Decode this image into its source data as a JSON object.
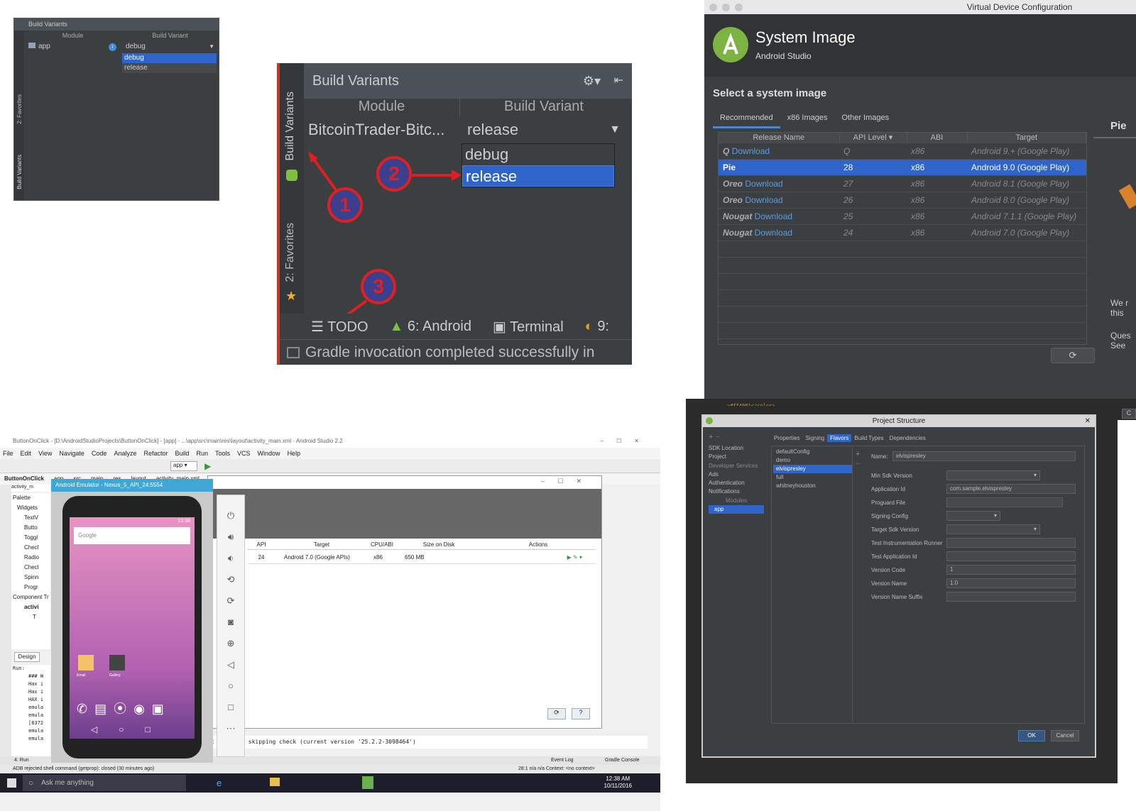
{
  "panel1": {
    "title": "Build Variants",
    "col_module": "Module",
    "col_variant": "Build Variant",
    "module": "app",
    "variant": "debug",
    "options": [
      "debug",
      "release"
    ],
    "side_favorites": "2: Favorites",
    "side_build": "Build Variants"
  },
  "panel2": {
    "title": "Build Variants",
    "col_module": "Module",
    "col_variant": "Build Variant",
    "module": "BitcoinTrader-Bitc...",
    "variant": "release",
    "options": [
      "debug",
      "release"
    ],
    "side_build": "Build Variants",
    "side_favorites": "2: Favorites",
    "markers": [
      "1",
      "2",
      "3"
    ],
    "bottom_tabs": [
      "TODO",
      "6: Android",
      "Terminal",
      "9:"
    ],
    "status": "Gradle invocation completed successfully in"
  },
  "panel3": {
    "window_title": "Virtual Device Configuration",
    "heading": "System Image",
    "subheading": "Android Studio",
    "prompt": "Select a system image",
    "tabs": [
      "Recommended",
      "x86 Images",
      "Other Images"
    ],
    "columns": [
      "Release Name",
      "API Level",
      "ABI",
      "Target"
    ],
    "rows": [
      {
        "name": "Q",
        "link": "Download",
        "api": "Q",
        "abi": "x86",
        "target": "Android 9.+ (Google Play)",
        "selected": false
      },
      {
        "name": "Pie",
        "link": "",
        "api": "28",
        "abi": "x86",
        "target": "Android 9.0 (Google Play)",
        "selected": true
      },
      {
        "name": "Oreo",
        "link": "Download",
        "api": "27",
        "abi": "x86",
        "target": "Android 8.1 (Google Play)",
        "selected": false
      },
      {
        "name": "Oreo",
        "link": "Download",
        "api": "26",
        "abi": "x86",
        "target": "Android 8.0 (Google Play)",
        "selected": false
      },
      {
        "name": "Nougat",
        "link": "Download",
        "api": "25",
        "abi": "x86",
        "target": "Android 7.1.1 (Google Play)",
        "selected": false
      },
      {
        "name": "Nougat",
        "link": "Download",
        "api": "24",
        "abi": "x86",
        "target": "Android 7.0 (Google Play)",
        "selected": false
      }
    ],
    "side_title": "Pie",
    "side_text1": "We r",
    "side_text2": "this",
    "side_text3": "Ques",
    "side_text4": "See"
  },
  "panel4": {
    "window_title": "ButtonOnClick - [D:\\AndroidStudioProjects\\ButtonOnClick] - [app] - ...\\app\\src\\main\\res\\layout\\activity_main.xml - Android Studio 2.2",
    "menu": [
      "File",
      "Edit",
      "View",
      "Navigate",
      "Code",
      "Analyze",
      "Refactor",
      "Build",
      "Run",
      "Tools",
      "VCS",
      "Window",
      "Help"
    ],
    "breadcrumbs": [
      "ButtonOnClick",
      "app",
      "src",
      "main",
      "res",
      "layout",
      "activity_main.xml"
    ],
    "file_tab": "activity_m",
    "emulator_title": "Android Emulator - Nexus_5_API_24:5554",
    "palette": "Palette",
    "palette_items": [
      "Widgets",
      "TextV",
      "Butto",
      "Toggl",
      "Checl",
      "Radio",
      "Checl",
      "Spinn",
      "Progr"
    ],
    "component_tree": "Component Tr",
    "tree_items": [
      "activi",
      "T"
    ],
    "design_tab": "Design",
    "run_label": "Run:",
    "avd_columns": [
      "API",
      "Target",
      "CPU/ABI",
      "Size on Disk",
      "Actions"
    ],
    "avd_row": {
      "api": "24",
      "target": "Android 7.0 (Google APIs)",
      "abi": "x86",
      "size": "650 MB"
    },
    "console_line": "st version, skipping check (current version '25.2.2-3098464')",
    "console_left": [
      "### W",
      "Hax i",
      "Hax i",
      "HAX i",
      "emula",
      "emula",
      "[8372",
      "emula",
      "emula"
    ],
    "status": "ADB rejected shell command (getprop): closed (30 minutes ago)",
    "status_right": "28:1  n/a  n/a  Context: <no context>",
    "event_log": "Event Log",
    "gradle_console": "Gradle Console",
    "terminal": "minal",
    "run_tab": "4: Run",
    "taskbar_search": "Ask me anything",
    "clock_time": "12:38 AM",
    "clock_date": "10/11/2016",
    "phone_time": "12:38",
    "google": "Google",
    "apps": [
      "Email",
      "Gallery"
    ],
    "device_combo": "app"
  },
  "panel5": {
    "code_line": ">#ff4081</color>",
    "window_title": "Project Structure",
    "nav": [
      "SDK Location",
      "Project",
      "Developer Services",
      "Ads",
      "Authentication",
      "Notifications",
      "Modules",
      "app"
    ],
    "tabs": [
      "Properties",
      "Signing",
      "Flavors",
      "Build Types",
      "Dependencies"
    ],
    "flavors": [
      "defaultConfig",
      "demo",
      "elvispresley",
      "full",
      "whitneyhouston"
    ],
    "name_label": "Name:",
    "name_value": "elvispresley",
    "fields": [
      {
        "label": "Min Sdk Version",
        "value": ""
      },
      {
        "label": "Application Id",
        "value": "com.sample.elvispresley"
      },
      {
        "label": "Proguard File",
        "value": ""
      },
      {
        "label": "Signing Config",
        "value": ""
      },
      {
        "label": "Target Sdk Version",
        "value": ""
      },
      {
        "label": "Test Instrumentation Runner",
        "value": ""
      },
      {
        "label": "Test Application Id",
        "value": ""
      },
      {
        "label": "Version Code",
        "value": "1"
      },
      {
        "label": "Version Name",
        "value": "1.0"
      },
      {
        "label": "Version Name Suffix",
        "value": ""
      }
    ],
    "ok": "OK",
    "cancel": "Cancel"
  }
}
